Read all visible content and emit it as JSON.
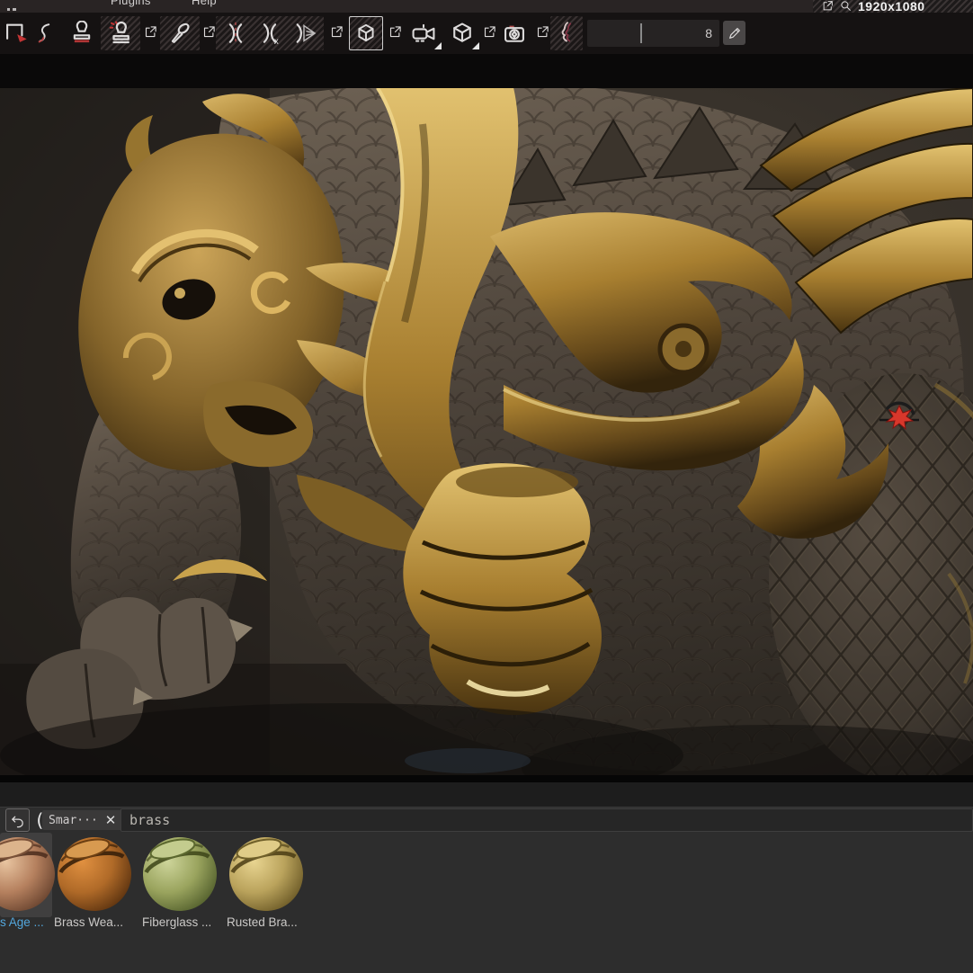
{
  "window": {
    "resolution_label": "1920x1080"
  },
  "menu": {
    "items": [
      {
        "label": "Plugins"
      },
      {
        "label": "Help"
      }
    ]
  },
  "toolbar": {
    "value_field": "8",
    "tool_icons": [
      "rect-select-tool-icon",
      "lasso-tool-icon",
      "stamp-tool-icon",
      "stencil-stamp-tool-icon",
      "brush-tool-icon",
      "symmetry-mirror-icon",
      "symmetry-x-icon",
      "symmetry-radial-icon",
      "perspective-cube-icon",
      "video-camera-icon",
      "cube-icon",
      "photo-camera-icon",
      "profile-curve-icon",
      "pencil-edit-icon",
      "external-link-icon"
    ]
  },
  "viewport": {
    "cursor_color": "#d8372b",
    "background_color": "#37322c",
    "model_gold_color": "#d9b768"
  },
  "shelf": {
    "icons": {
      "undo": "undo-arrow",
      "bracket": "(",
      "close": "✕",
      "search_field": "text-input"
    },
    "filter_tag": "Smar···",
    "search_value": "brass",
    "materials": [
      {
        "label": "s Age ...",
        "selected": true,
        "base_color": "#b5805e"
      },
      {
        "label": "Brass Wea...",
        "selected": false,
        "base_color": "#b06a28"
      },
      {
        "label": "Fiberglass ...",
        "selected": false,
        "base_color": "#9aa45e"
      },
      {
        "label": "Rusted Bra...",
        "selected": false,
        "base_color": "#baa35c"
      }
    ]
  },
  "colors": {
    "selection_accent": "#53a7dd",
    "tool_accent_red": "#c23434"
  }
}
